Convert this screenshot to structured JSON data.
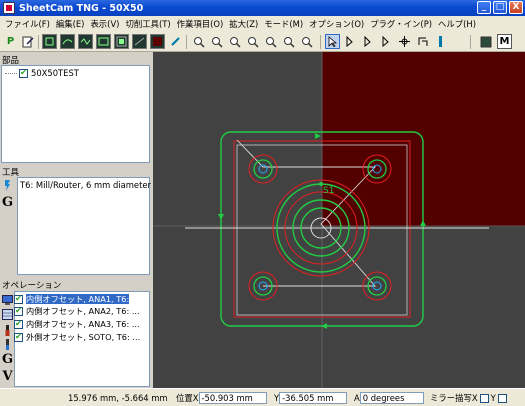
{
  "window": {
    "title": "SheetCam TNG - 50X50",
    "controls": [
      "_",
      "□",
      "X"
    ]
  },
  "menu": [
    "ファイル(F)",
    "編集(E)",
    "表示(V)",
    "切削工具(T)",
    "作業項目(O)",
    "拡大(Z)",
    "モード(M)",
    "オプション(O)",
    "プラグ・イン(P)",
    "ヘルプ(H)"
  ],
  "toolbar": {
    "post_label": "P",
    "m_label": "M"
  },
  "parts_panel": {
    "header": "部品",
    "item": "50X50TEST",
    "checked": true
  },
  "tool_panel": {
    "header": "工具",
    "tool": "T6: Mill/Router, 6 mm diameter"
  },
  "operations_panel": {
    "header": "オペレーション",
    "operations": [
      {
        "label": "内側オフセット, ANA1, T6:",
        "checked": true,
        "selected": true
      },
      {
        "label": "内側オフセット, ANA2, T6: ...",
        "checked": true,
        "selected": false
      },
      {
        "label": "内側オフセット, ANA3, T6: ...",
        "checked": true,
        "selected": false
      },
      {
        "label": "外側オフセット, SOTO, T6: ...",
        "checked": true,
        "selected": false
      }
    ]
  },
  "viewport": {
    "start_label": "S1",
    "colors": {
      "background": "#424242",
      "material": "#520000",
      "path": "#22cc44",
      "part": "#e02020",
      "rapid": "#dddddd"
    }
  },
  "status": {
    "coords": "15.976 mm, -5.664 mm",
    "pos_label": "位置X",
    "pos_x": "-50.903 mm",
    "y_label": "Y",
    "pos_y": "-36.505 mm",
    "a_label": "A",
    "angle": "0 degrees",
    "mirror_label": "ミラー描写X",
    "mirror_y": "Y"
  }
}
